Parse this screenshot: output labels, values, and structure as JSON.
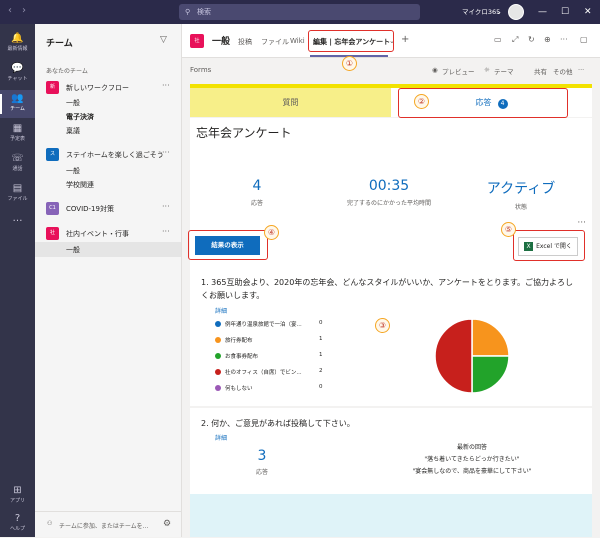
{
  "titlebar": {
    "search_placeholder": "検索",
    "org": "マイクロ365",
    "back": "‹",
    "forward": "›",
    "minimize": "—",
    "maximize": "☐",
    "close": "✕"
  },
  "rail": [
    {
      "label": "最新情報",
      "icon": "bell-icon",
      "glyph": "🔔"
    },
    {
      "label": "チャット",
      "icon": "chat-icon",
      "glyph": "💬"
    },
    {
      "label": "チーム",
      "icon": "teams-icon",
      "glyph": "👥"
    },
    {
      "label": "予定表",
      "icon": "calendar-icon",
      "glyph": "▦"
    },
    {
      "label": "通話",
      "icon": "phone-icon",
      "glyph": "☏"
    },
    {
      "label": "ファイル",
      "icon": "file-icon",
      "glyph": "▤"
    },
    {
      "label": "…",
      "icon": "more-icon",
      "glyph": ""
    },
    {
      "label": "アプリ",
      "icon": "apps-icon",
      "glyph": "⊞"
    },
    {
      "label": "ヘルプ",
      "icon": "help-icon",
      "glyph": "?"
    }
  ],
  "teams_pane": {
    "title": "チーム",
    "section": "あなたのチーム",
    "teams": [
      {
        "name": "新しいワークフロー",
        "avatar": "新",
        "color": "#e8115a",
        "channels": [
          "一般",
          "電子決済",
          "稟議"
        ]
      },
      {
        "name": "ステイホームを楽しく過ごそう",
        "avatar": "ス",
        "color": "#0f6cbd",
        "channels": [
          "一般",
          "学校関連"
        ]
      },
      {
        "name": "COVID-19対策",
        "avatar": "C1",
        "color": "#8764b8",
        "channels": []
      },
      {
        "name": "社内イベント・行事",
        "avatar": "社",
        "color": "#e8115a",
        "channels": [
          "一般"
        ]
      }
    ],
    "footer": "チームに参加、またはチームを..."
  },
  "channel_header": {
    "avatar": "社",
    "name": "一般",
    "tabs": [
      "投稿",
      "ファイル",
      "Wiki",
      "編集 | 忘年会アンケート"
    ],
    "add": "+"
  },
  "forms_bar": {
    "label": "Forms",
    "preview": "プレビュー",
    "theme": "テーマ",
    "share": "共有",
    "more": "その他"
  },
  "form_tabs": {
    "questions": "質問",
    "responses": "応答",
    "response_badge": "4"
  },
  "form": {
    "title": "忘年会アンケート",
    "stats": [
      {
        "value": "4",
        "label": "応答"
      },
      {
        "value": "00:35",
        "label": "完了するのにかかった平均時間"
      },
      {
        "value": "アクティブ",
        "label": "状態"
      }
    ],
    "view_results": "結果の表示",
    "open_excel": "Excel で開く",
    "q1": {
      "text": "1.  365互助会より、2020年の忘年会、どんなスタイルがいいか、アンケートをとります。ご協力よろしくお願いします。",
      "detail": "詳細",
      "options": [
        {
          "label": "例年通り温泉旅館で一泊（宴...",
          "count": "0",
          "color": "#0f6cbd"
        },
        {
          "label": "旅行券配布",
          "count": "1",
          "color": "#f7941d"
        },
        {
          "label": "お食事券配布",
          "count": "1",
          "color": "#22a32a"
        },
        {
          "label": "社のオフィス（自席）でビン...",
          "count": "2",
          "color": "#c7201c"
        },
        {
          "label": "何もしない",
          "count": "0",
          "color": "#9b59b6"
        }
      ]
    },
    "q2": {
      "text": "2.  何か、ご意見があれば投稿して下さい。",
      "detail": "詳細",
      "value": "3",
      "label": "応答",
      "latest_title": "最新の回答",
      "latest": [
        "\"落ち着いてきたらどっか行きたい\"",
        "\"宴会無しなので、商品を豪華にして下さい\""
      ]
    }
  },
  "callouts": [
    "①",
    "②",
    "③",
    "④",
    "⑤"
  ],
  "chart_data": {
    "type": "pie",
    "categories": [
      "例年通り温泉旅館で一泊（宴...",
      "旅行券配布",
      "お食事券配布",
      "社のオフィス（自席）でビン...",
      "何もしない"
    ],
    "values": [
      0,
      1,
      1,
      2,
      0
    ],
    "colors": [
      "#0f6cbd",
      "#f7941d",
      "#22a32a",
      "#c7201c",
      "#9b59b6"
    ]
  }
}
